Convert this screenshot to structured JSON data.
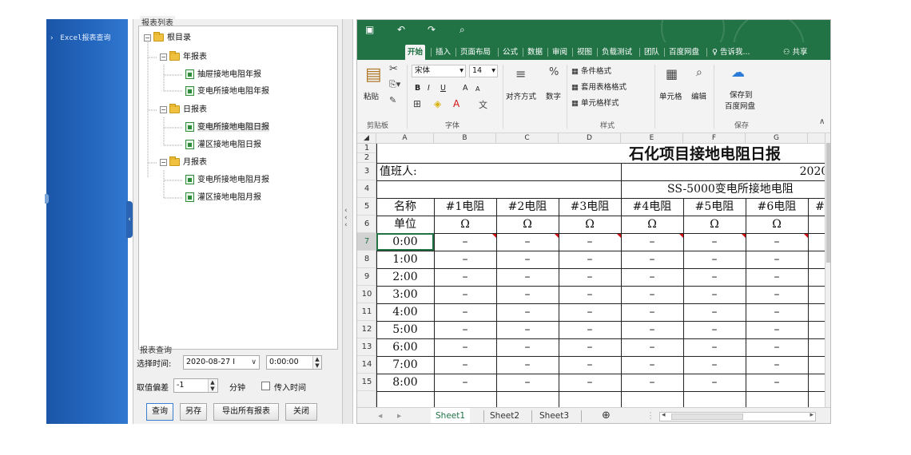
{
  "sidebar": {
    "items": [
      {
        "label": "Excel报表查询"
      }
    ]
  },
  "report_list": {
    "group_label": "报表列表",
    "tree": {
      "root": "根目录",
      "year_folder": "年报表",
      "year_items": [
        "抽屉接地电阻年报",
        "变电所接地电阻年报"
      ],
      "day_folder": "日报表",
      "day_items": [
        "变电所接地电阻日报",
        "灌区接地电阻日报"
      ],
      "month_folder": "月报表",
      "month_items": [
        "变电所接地电阻月报",
        "灌区接地电阻月报"
      ]
    }
  },
  "query": {
    "group_label": "报表查询",
    "time_label": "选择时间:",
    "date_value": "2020-08-27 I",
    "time_value": "0:00:00",
    "offset_label": "取值偏差",
    "offset_value": "-1",
    "minute_label": "分钟",
    "input_time_label": "传入时间",
    "buttons": {
      "query": "查询",
      "save_as": "另存",
      "export_all": "导出所有报表",
      "close": "关闭"
    }
  },
  "excel": {
    "tabs": [
      "开始",
      "插入",
      "页面布局",
      "公式",
      "数据",
      "审阅",
      "视图",
      "负载测试",
      "团队",
      "百度网盘"
    ],
    "tell_me": "告诉我...",
    "share": "共享",
    "ribbon": {
      "paste": "粘贴",
      "font_name": "宋体",
      "font_size": "14",
      "bold": "B",
      "italic": "I",
      "underline": "U",
      "grow_font": "A",
      "shrink_font": "A",
      "align": "对齐方式",
      "number": "数字",
      "cond_format": "条件格式",
      "table_format": "套用表格格式",
      "cell_style": "单元格样式",
      "cells": "单元格",
      "editing": "编辑",
      "save_to": "保存到",
      "baidu": "百度网盘",
      "group_clipboard": "剪贴板",
      "group_font": "字体",
      "group_style": "样式",
      "group_save": "保存"
    },
    "columns": [
      "A",
      "B",
      "C",
      "D",
      "E",
      "F",
      "G"
    ],
    "rows": [
      "1",
      "2",
      "3",
      "4",
      "5",
      "6",
      "7",
      "8",
      "9",
      "10",
      "11",
      "12",
      "13",
      "14",
      "15"
    ],
    "sheet": {
      "title": "石化项目接地电阻日报",
      "duty_label": "值班人:",
      "date_partial": "2020/",
      "subheader": "SS-5000变电所接地电阻",
      "header": [
        "名称",
        "#1电阻",
        "#2电阻",
        "#3电阻",
        "#4电阻",
        "#5电阻",
        "#6电阻",
        "#"
      ],
      "units": [
        "单位",
        "Ω",
        "Ω",
        "Ω",
        "Ω",
        "Ω",
        "Ω"
      ],
      "times": [
        "0:00",
        "1:00",
        "2:00",
        "3:00",
        "4:00",
        "5:00",
        "6:00",
        "7:00",
        "8:00"
      ],
      "empty_value": "–"
    },
    "sheet_tabs": [
      "Sheet1",
      "Sheet2",
      "Sheet3"
    ],
    "add_sheet": "⊕"
  }
}
